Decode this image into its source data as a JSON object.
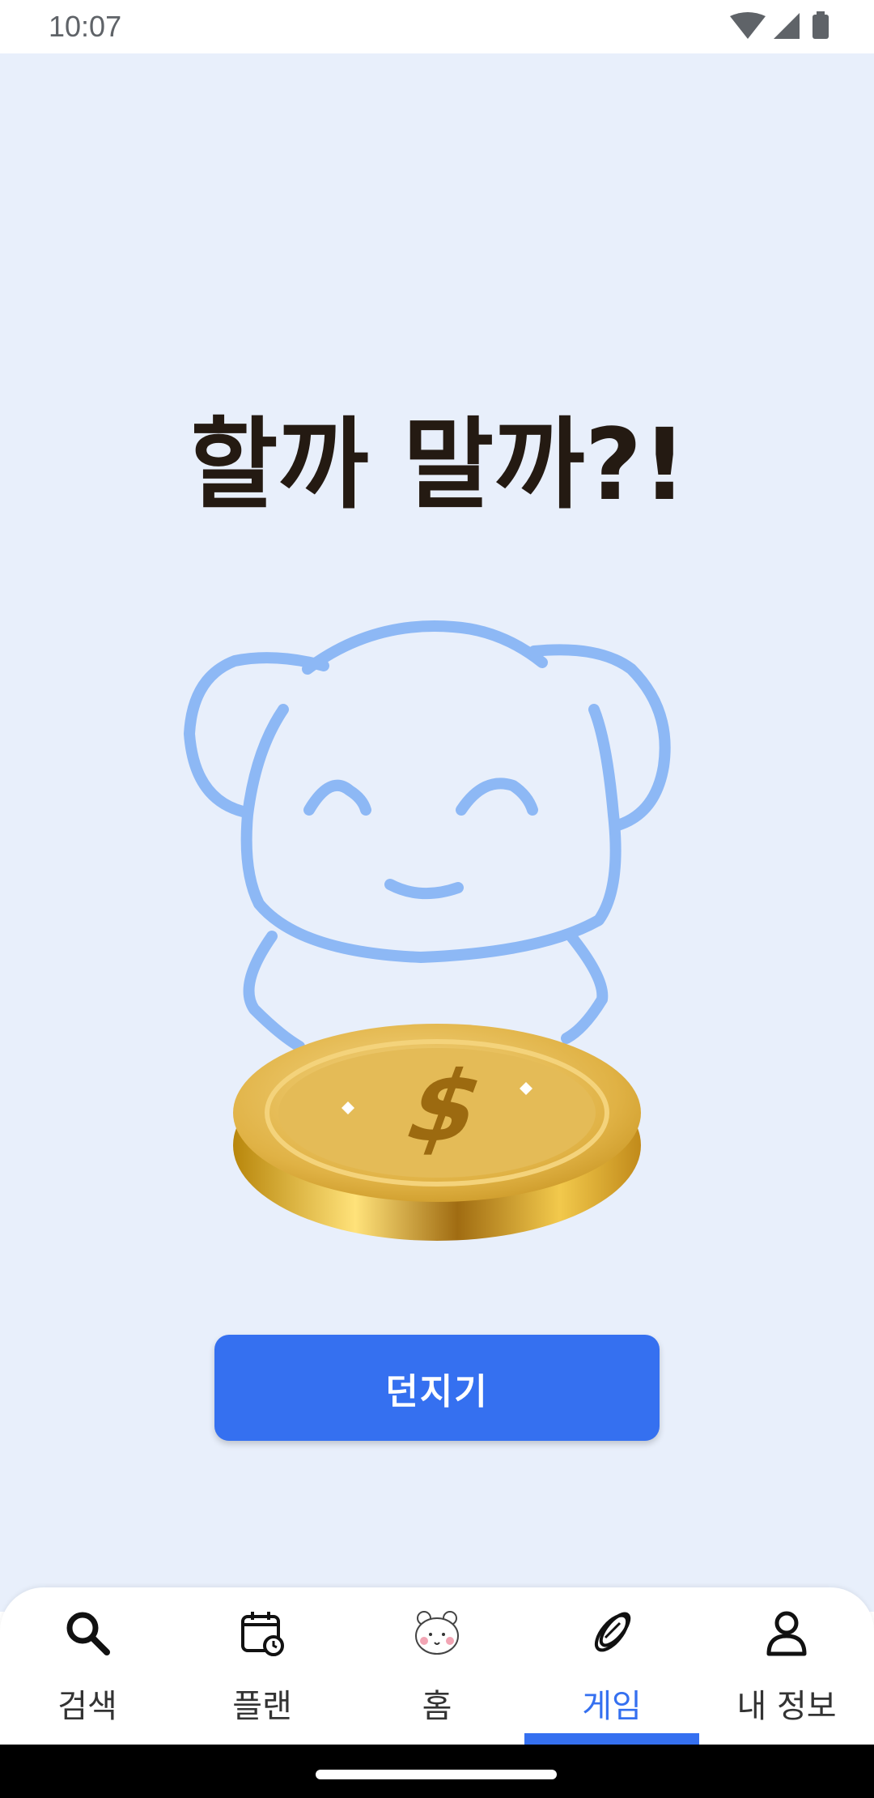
{
  "status_bar": {
    "time": "10:07"
  },
  "main": {
    "title": "할까 말까?!",
    "button_label": "던지기",
    "accent_color": "#3570f0",
    "background_color": "#e8effb"
  },
  "nav": {
    "items": [
      {
        "label": "검색",
        "icon": "search-icon"
      },
      {
        "label": "플랜",
        "icon": "calendar-icon"
      },
      {
        "label": "홈",
        "icon": "bear-icon"
      },
      {
        "label": "게임",
        "icon": "coin-icon",
        "active": true
      },
      {
        "label": "내 정보",
        "icon": "person-icon"
      }
    ]
  }
}
